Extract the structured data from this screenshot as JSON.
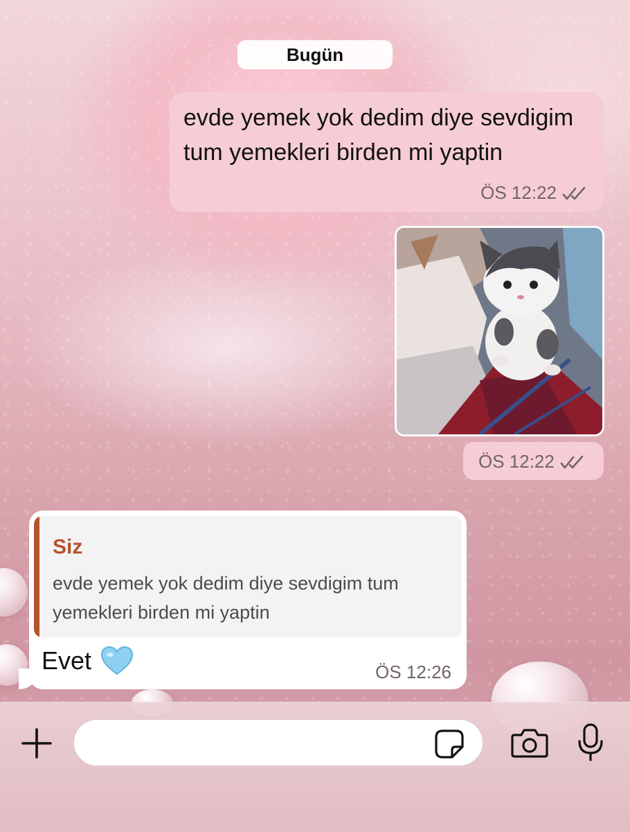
{
  "chat": {
    "date_separator": "Bugün",
    "messages": [
      {
        "direction": "outgoing",
        "text": "evde yemek yok dedim diye sevdigim tum yemekleri birden mi yaptin",
        "time": "ÖS 12:22",
        "status_icon": "double-check-icon"
      },
      {
        "direction": "outgoing",
        "type": "image",
        "image_description": "kitten",
        "time": "ÖS 12:22",
        "status_icon": "double-check-icon"
      },
      {
        "direction": "incoming",
        "quoted": {
          "sender": "Siz",
          "text": "evde yemek yok dedim diye sevdigim tum yemekleri birden mi yaptin"
        },
        "text": "Evet",
        "emoji": "light-blue-heart",
        "time": "ÖS 12:26"
      }
    ]
  },
  "composer": {
    "add_icon": "plus-icon",
    "input_value": "",
    "sticker_icon": "sticker-icon",
    "camera_icon": "camera-icon",
    "mic_icon": "microphone-icon"
  },
  "colors": {
    "outgoing_bubble": "#f6cdd4",
    "incoming_bubble": "#ffffff",
    "quote_accent": "#b5532d",
    "heart": "#8fd0f0"
  }
}
